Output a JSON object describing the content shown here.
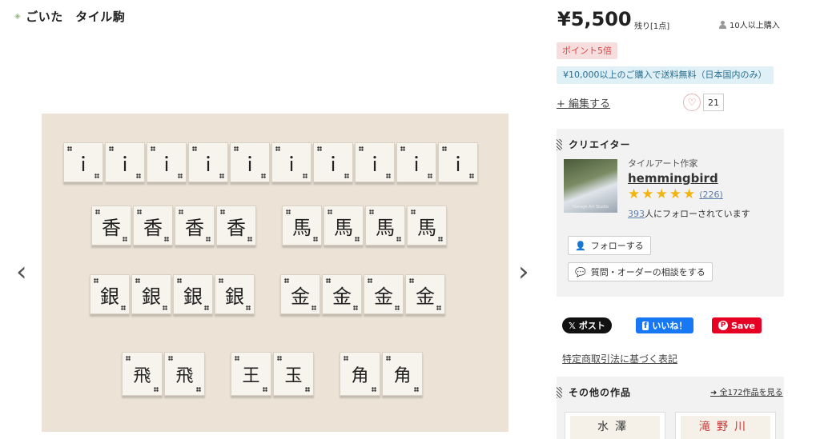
{
  "product": {
    "title": "ごいた　タイル駒",
    "price": "¥5,500",
    "stock": "残り[1点]",
    "buyers": "10人以上購入",
    "point_badge": "ポイント5倍",
    "shipping_badge": "¥10,000以上のご購入で送料無料（日本国内のみ）",
    "edit_label": "+ 編集する",
    "favorites": "21"
  },
  "gallery": {
    "row1": [
      "ｉ",
      "ｉ",
      "ｉ",
      "ｉ",
      "ｉ",
      "ｉ",
      "ｉ",
      "ｉ",
      "ｉ",
      "ｉ"
    ],
    "row2": [
      "香",
      "香",
      "香",
      "香",
      "馬",
      "馬",
      "馬",
      "馬"
    ],
    "row3": [
      "銀",
      "銀",
      "銀",
      "銀",
      "金",
      "金",
      "金",
      "金"
    ],
    "row4": [
      "飛",
      "飛",
      "王",
      "玉",
      "角",
      "角"
    ]
  },
  "creator": {
    "section_title": "クリエイター",
    "role": "タイルアート作家",
    "name": "hemmingbird",
    "review_count": "(226)",
    "followers_count": "393",
    "followers_suffix": "人にフォローされています",
    "follow_button": "フォローする",
    "consult_button": "質問・オーダーの相談をする",
    "avatar_caption": "Garage Art Studio"
  },
  "share": {
    "x_label": "ポスト",
    "fb_label": "いいね！",
    "pin_label": "Save"
  },
  "tokutei": "特定商取引法に基づく表記",
  "other_works": {
    "section_title": "その他の作品",
    "see_all": "全172作品を見る",
    "thumb1": "水澤",
    "thumb2": "滝野川"
  },
  "colors": {
    "point": "#dd4444",
    "ship": "#2a6f91",
    "star": "#f2b411"
  }
}
